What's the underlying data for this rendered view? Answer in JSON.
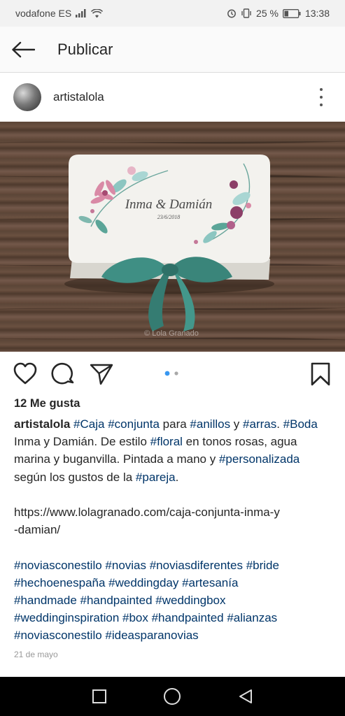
{
  "status_bar": {
    "carrier": "vodafone ES",
    "battery": "25 %",
    "time": "13:38"
  },
  "app_bar": {
    "title": "Publicar",
    "back_icon": "arrow-left-icon"
  },
  "post": {
    "username": "artistalola",
    "image_watermark": "© Lola Granado",
    "box_names": "Inma & Damián",
    "box_date": "23/6/2018",
    "carousel_dots": 2,
    "carousel_active": 1,
    "likes": "12 Me gusta",
    "caption": {
      "user": "artistalola",
      "p1": [
        {
          "t": " ",
          "h": false
        },
        {
          "t": "#Caja",
          "h": true
        },
        {
          "t": " ",
          "h": false
        },
        {
          "t": "#conjunta",
          "h": true
        },
        {
          "t": " para ",
          "h": false
        },
        {
          "t": "#anillos",
          "h": true
        },
        {
          "t": " y ",
          "h": false
        },
        {
          "t": "#arras",
          "h": true
        },
        {
          "t": ". ",
          "h": false
        },
        {
          "t": "#Boda",
          "h": true
        },
        {
          "t": " Inma y Damián. De estilo ",
          "h": false
        },
        {
          "t": "#floral",
          "h": true
        },
        {
          "t": " en tonos rosas, agua marina y buganvilla. Pintada a mano y ",
          "h": false
        },
        {
          "t": "#personalizada",
          "h": true
        },
        {
          "t": " según los gustos de la ",
          "h": false
        },
        {
          "t": "#pareja",
          "h": true
        },
        {
          "t": ".",
          "h": false
        }
      ],
      "url_line1": "https://www.lolagranado.com/caja-conjunta-inma-y",
      "url_line2": "-damian/",
      "hashtag_lines": [
        "#noviasconestilo #novias #noviasdiferentes #bride",
        "#hechoenespaña #weddingday #artesanía",
        "#handmade #handpainted #weddingbox",
        "#weddinginspiration #box #handpainted #alianzas",
        "#noviasconestilo #ideasparanovias"
      ]
    },
    "date": "21 de mayo"
  },
  "colors": {
    "hashtag": "#003569",
    "active_dot": "#3897f0",
    "ribbon": "#3f8f84"
  }
}
